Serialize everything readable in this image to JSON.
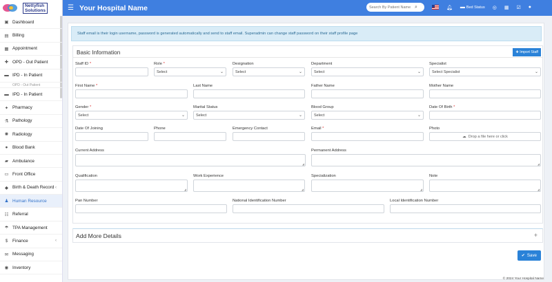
{
  "header": {
    "logo_line1": "Nettyfish",
    "logo_line2": "Solutions",
    "title": "Your Hospital Name",
    "search_placeholder": "Search By Patient Name",
    "bed_status": "Bed Status"
  },
  "sidebar": {
    "items": [
      {
        "label": "Dashboard",
        "icon": "▣"
      },
      {
        "label": "Billing",
        "icon": "▤"
      },
      {
        "label": "Appointment",
        "icon": "▦"
      },
      {
        "label": "OPD - Out Patient",
        "icon": "✚"
      },
      {
        "label": "IPD - In Patient",
        "icon": "▬"
      },
      {
        "label": "OPD - Out Patient",
        "icon": ""
      },
      {
        "label": "IPD - In Patient",
        "icon": "▬"
      },
      {
        "label": "Pharmacy",
        "icon": "✦"
      },
      {
        "label": "Pathology",
        "icon": "⚗"
      },
      {
        "label": "Radiology",
        "icon": "✺"
      },
      {
        "label": "Blood Bank",
        "icon": "●"
      },
      {
        "label": "Ambulance",
        "icon": "▰"
      },
      {
        "label": "Front Office",
        "icon": "▭"
      },
      {
        "label": "Birth & Death Record",
        "icon": "◆",
        "arrow": "‹"
      },
      {
        "label": "Human Resource",
        "icon": "♟"
      },
      {
        "label": "Referral",
        "icon": "☷"
      },
      {
        "label": "TPA Management",
        "icon": "☂"
      },
      {
        "label": "Finance",
        "icon": "$",
        "arrow": "‹"
      },
      {
        "label": "Messaging",
        "icon": "✉"
      },
      {
        "label": "Inventory",
        "icon": "◉"
      }
    ]
  },
  "alert": "Staff email is their login username, password is generated automatically and send to staff email. Superadmin can change staff password on their staff profile page",
  "basic": {
    "title": "Basic Information",
    "import_label": "Import Staff",
    "fields": {
      "staff_id": "Staff ID",
      "role": "Role",
      "designation": "Designation",
      "department": "Department",
      "specialist": "Specialist",
      "first_name": "First Name",
      "last_name": "Last Name",
      "father_name": "Father Name",
      "mother_name": "Mother Name",
      "gender": "Gender",
      "marital_status": "Marital Status",
      "blood_group": "Blood Group",
      "dob": "Date Of Birth",
      "doj": "Date Of Joining",
      "phone": "Phone",
      "emergency": "Emergency Contact",
      "email": "Email",
      "photo": "Photo",
      "current_address": "Current Address",
      "permanent_address": "Permanent Address",
      "qualification": "Qualification",
      "work_experience": "Work Experience",
      "specialization": "Specialization",
      "note": "Note",
      "pan": "Pan Number",
      "national_id": "National Identification Number",
      "local_id": "Local Identification Number"
    },
    "select_placeholder": "Select",
    "specialist_placeholder": "Select Specialist",
    "upload_text": "Drop a file here or click",
    "required_mark": "*"
  },
  "more_title": "Add More Details",
  "save_label": "Save",
  "footer": "© 2024 Your Hospital Name"
}
